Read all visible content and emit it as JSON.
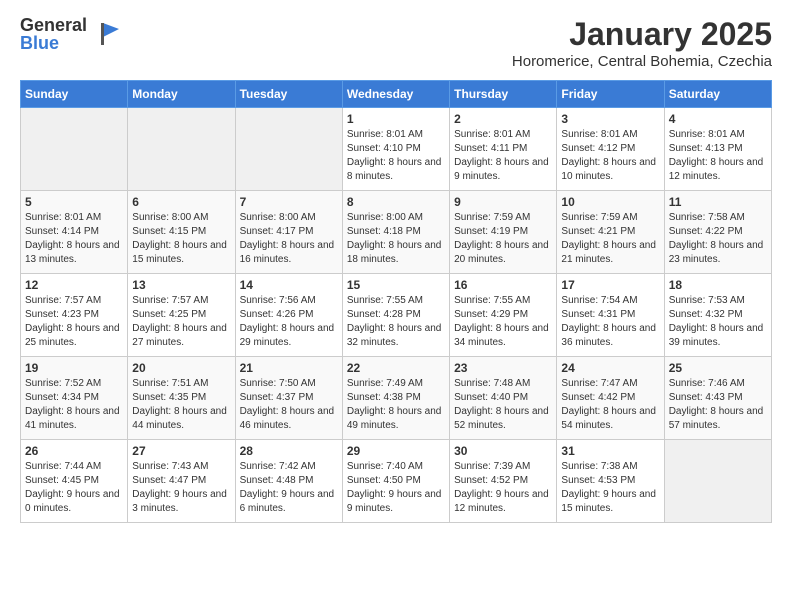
{
  "logo": {
    "general": "General",
    "blue": "Blue"
  },
  "header": {
    "month": "January 2025",
    "location": "Horomerice, Central Bohemia, Czechia"
  },
  "weekdays": [
    "Sunday",
    "Monday",
    "Tuesday",
    "Wednesday",
    "Thursday",
    "Friday",
    "Saturday"
  ],
  "weeks": [
    [
      {
        "day": "",
        "info": ""
      },
      {
        "day": "",
        "info": ""
      },
      {
        "day": "",
        "info": ""
      },
      {
        "day": "1",
        "info": "Sunrise: 8:01 AM\nSunset: 4:10 PM\nDaylight: 8 hours and 8 minutes."
      },
      {
        "day": "2",
        "info": "Sunrise: 8:01 AM\nSunset: 4:11 PM\nDaylight: 8 hours and 9 minutes."
      },
      {
        "day": "3",
        "info": "Sunrise: 8:01 AM\nSunset: 4:12 PM\nDaylight: 8 hours and 10 minutes."
      },
      {
        "day": "4",
        "info": "Sunrise: 8:01 AM\nSunset: 4:13 PM\nDaylight: 8 hours and 12 minutes."
      }
    ],
    [
      {
        "day": "5",
        "info": "Sunrise: 8:01 AM\nSunset: 4:14 PM\nDaylight: 8 hours and 13 minutes."
      },
      {
        "day": "6",
        "info": "Sunrise: 8:00 AM\nSunset: 4:15 PM\nDaylight: 8 hours and 15 minutes."
      },
      {
        "day": "7",
        "info": "Sunrise: 8:00 AM\nSunset: 4:17 PM\nDaylight: 8 hours and 16 minutes."
      },
      {
        "day": "8",
        "info": "Sunrise: 8:00 AM\nSunset: 4:18 PM\nDaylight: 8 hours and 18 minutes."
      },
      {
        "day": "9",
        "info": "Sunrise: 7:59 AM\nSunset: 4:19 PM\nDaylight: 8 hours and 20 minutes."
      },
      {
        "day": "10",
        "info": "Sunrise: 7:59 AM\nSunset: 4:21 PM\nDaylight: 8 hours and 21 minutes."
      },
      {
        "day": "11",
        "info": "Sunrise: 7:58 AM\nSunset: 4:22 PM\nDaylight: 8 hours and 23 minutes."
      }
    ],
    [
      {
        "day": "12",
        "info": "Sunrise: 7:57 AM\nSunset: 4:23 PM\nDaylight: 8 hours and 25 minutes."
      },
      {
        "day": "13",
        "info": "Sunrise: 7:57 AM\nSunset: 4:25 PM\nDaylight: 8 hours and 27 minutes."
      },
      {
        "day": "14",
        "info": "Sunrise: 7:56 AM\nSunset: 4:26 PM\nDaylight: 8 hours and 29 minutes."
      },
      {
        "day": "15",
        "info": "Sunrise: 7:55 AM\nSunset: 4:28 PM\nDaylight: 8 hours and 32 minutes."
      },
      {
        "day": "16",
        "info": "Sunrise: 7:55 AM\nSunset: 4:29 PM\nDaylight: 8 hours and 34 minutes."
      },
      {
        "day": "17",
        "info": "Sunrise: 7:54 AM\nSunset: 4:31 PM\nDaylight: 8 hours and 36 minutes."
      },
      {
        "day": "18",
        "info": "Sunrise: 7:53 AM\nSunset: 4:32 PM\nDaylight: 8 hours and 39 minutes."
      }
    ],
    [
      {
        "day": "19",
        "info": "Sunrise: 7:52 AM\nSunset: 4:34 PM\nDaylight: 8 hours and 41 minutes."
      },
      {
        "day": "20",
        "info": "Sunrise: 7:51 AM\nSunset: 4:35 PM\nDaylight: 8 hours and 44 minutes."
      },
      {
        "day": "21",
        "info": "Sunrise: 7:50 AM\nSunset: 4:37 PM\nDaylight: 8 hours and 46 minutes."
      },
      {
        "day": "22",
        "info": "Sunrise: 7:49 AM\nSunset: 4:38 PM\nDaylight: 8 hours and 49 minutes."
      },
      {
        "day": "23",
        "info": "Sunrise: 7:48 AM\nSunset: 4:40 PM\nDaylight: 8 hours and 52 minutes."
      },
      {
        "day": "24",
        "info": "Sunrise: 7:47 AM\nSunset: 4:42 PM\nDaylight: 8 hours and 54 minutes."
      },
      {
        "day": "25",
        "info": "Sunrise: 7:46 AM\nSunset: 4:43 PM\nDaylight: 8 hours and 57 minutes."
      }
    ],
    [
      {
        "day": "26",
        "info": "Sunrise: 7:44 AM\nSunset: 4:45 PM\nDaylight: 9 hours and 0 minutes."
      },
      {
        "day": "27",
        "info": "Sunrise: 7:43 AM\nSunset: 4:47 PM\nDaylight: 9 hours and 3 minutes."
      },
      {
        "day": "28",
        "info": "Sunrise: 7:42 AM\nSunset: 4:48 PM\nDaylight: 9 hours and 6 minutes."
      },
      {
        "day": "29",
        "info": "Sunrise: 7:40 AM\nSunset: 4:50 PM\nDaylight: 9 hours and 9 minutes."
      },
      {
        "day": "30",
        "info": "Sunrise: 7:39 AM\nSunset: 4:52 PM\nDaylight: 9 hours and 12 minutes."
      },
      {
        "day": "31",
        "info": "Sunrise: 7:38 AM\nSunset: 4:53 PM\nDaylight: 9 hours and 15 minutes."
      },
      {
        "day": "",
        "info": ""
      }
    ]
  ]
}
